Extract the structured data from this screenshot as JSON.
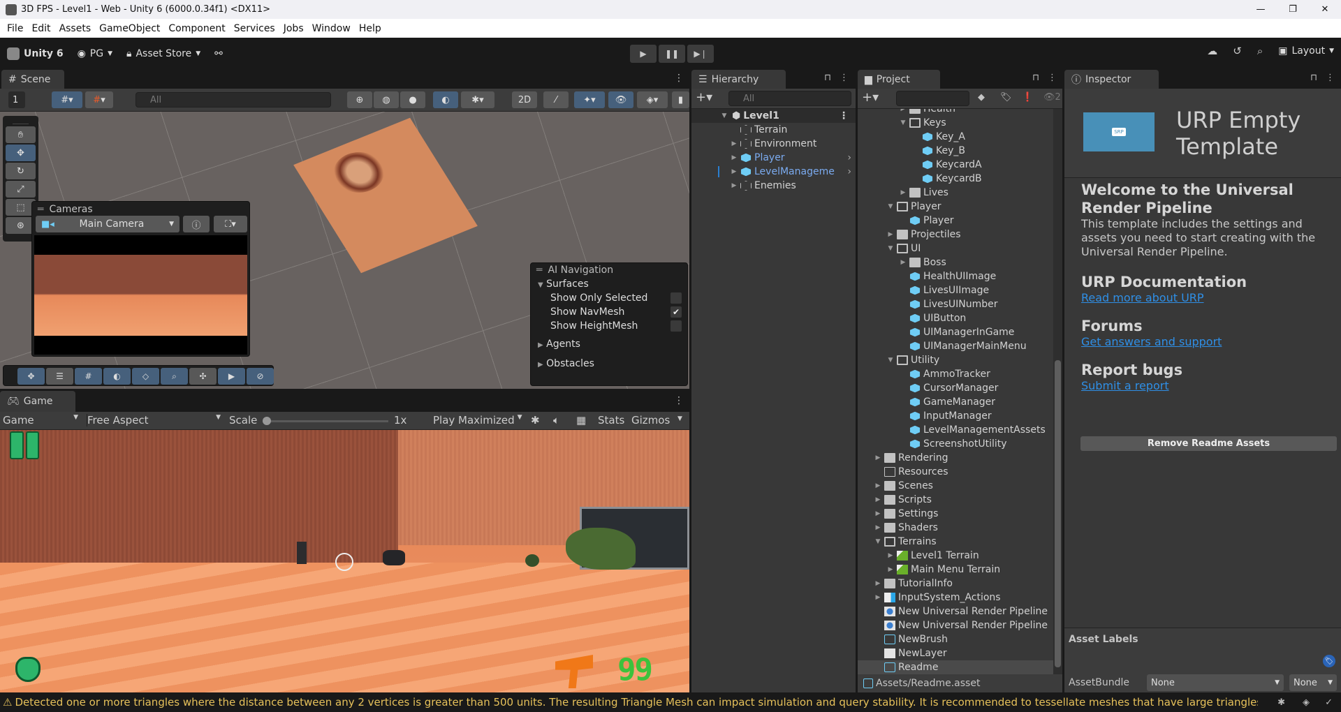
{
  "window": {
    "title": "3D FPS - Level1 - Web - Unity 6 (6000.0.34f1) <DX11>",
    "min": "—",
    "max": "❐",
    "close": "✕"
  },
  "menu": [
    "File",
    "Edit",
    "Assets",
    "GameObject",
    "Component",
    "Services",
    "Jobs",
    "Window",
    "Help"
  ],
  "toolbar": {
    "unity": "Unity 6",
    "account": "PG",
    "asset_store": "Asset Store",
    "layout": "Layout"
  },
  "scene": {
    "tab": "Scene",
    "grid_value": "1",
    "search_placeholder": "All",
    "cameras": {
      "title": "Cameras",
      "camera": "Main Camera"
    },
    "ai_nav": {
      "title": "AI Navigation",
      "surfaces": "Surfaces",
      "options": [
        {
          "label": "Show Only Selected",
          "checked": false
        },
        {
          "label": "Show NavMesh",
          "checked": true
        },
        {
          "label": "Show HeightMesh",
          "checked": false
        }
      ],
      "agents": "Agents",
      "obstacles": "Obstacles"
    }
  },
  "game": {
    "tab": "Game",
    "display": "Game",
    "aspect": "Free Aspect",
    "scale_label": "Scale",
    "scale_value": "1x",
    "scale": 0,
    "play_mode": "Play Maximized",
    "stats": "Stats",
    "gizmos": "Gizmos",
    "ammo": "99"
  },
  "hierarchy": {
    "tab": "Hierarchy",
    "search_placeholder": "All",
    "scene": "Level1",
    "items": [
      {
        "label": "Terrain",
        "icon": "gameobject",
        "arrow": false,
        "prefab": false
      },
      {
        "label": "Environment",
        "icon": "gameobject",
        "arrow": true,
        "prefab": false
      },
      {
        "label": "Player",
        "icon": "prefab",
        "arrow": true,
        "prefab": true
      },
      {
        "label": "LevelManageme",
        "icon": "prefab",
        "arrow": true,
        "prefab": true
      },
      {
        "label": "Enemies",
        "icon": "gameobject",
        "arrow": true,
        "prefab": false
      }
    ]
  },
  "project": {
    "tab": "Project",
    "hidden_count": "2",
    "path": "Assets/Readme.asset",
    "items": [
      {
        "l": 2,
        "a": "c",
        "i": "fold",
        "t": "Health"
      },
      {
        "l": 2,
        "a": "o",
        "i": "fold open",
        "t": "Keys"
      },
      {
        "l": 3,
        "a": "",
        "i": "prefab",
        "t": "Key_A"
      },
      {
        "l": 3,
        "a": "",
        "i": "prefab",
        "t": "Key_B"
      },
      {
        "l": 3,
        "a": "",
        "i": "prefab",
        "t": "KeycardA"
      },
      {
        "l": 3,
        "a": "",
        "i": "prefab",
        "t": "KeycardB"
      },
      {
        "l": 2,
        "a": "c",
        "i": "fold",
        "t": "Lives"
      },
      {
        "l": 1,
        "a": "o",
        "i": "fold open",
        "t": "Player"
      },
      {
        "l": 2,
        "a": "",
        "i": "prefab",
        "t": "Player"
      },
      {
        "l": 1,
        "a": "c",
        "i": "fold",
        "t": "Projectiles"
      },
      {
        "l": 1,
        "a": "o",
        "i": "fold open",
        "t": "UI"
      },
      {
        "l": 2,
        "a": "c",
        "i": "fold",
        "t": "Boss"
      },
      {
        "l": 2,
        "a": "",
        "i": "prefab",
        "t": "HealthUIImage"
      },
      {
        "l": 2,
        "a": "",
        "i": "prefab",
        "t": "LivesUIImage"
      },
      {
        "l": 2,
        "a": "",
        "i": "prefab",
        "t": "LivesUINumber"
      },
      {
        "l": 2,
        "a": "",
        "i": "prefab",
        "t": "UIButton"
      },
      {
        "l": 2,
        "a": "",
        "i": "prefab",
        "t": "UIManagerInGame"
      },
      {
        "l": 2,
        "a": "",
        "i": "prefab",
        "t": "UIManagerMainMenu"
      },
      {
        "l": 1,
        "a": "o",
        "i": "fold open",
        "t": "Utility"
      },
      {
        "l": 2,
        "a": "",
        "i": "prefab",
        "t": "AmmoTracker"
      },
      {
        "l": 2,
        "a": "",
        "i": "prefab",
        "t": "CursorManager"
      },
      {
        "l": 2,
        "a": "",
        "i": "prefab",
        "t": "GameManager"
      },
      {
        "l": 2,
        "a": "",
        "i": "prefab",
        "t": "InputManager"
      },
      {
        "l": 2,
        "a": "",
        "i": "prefab",
        "t": "LevelManagementAssets"
      },
      {
        "l": 2,
        "a": "",
        "i": "prefab",
        "t": "ScreenshotUtility"
      },
      {
        "l": 0,
        "a": "c",
        "i": "fold",
        "t": "Rendering"
      },
      {
        "l": 0,
        "a": "",
        "i": "fold empty",
        "t": "Resources"
      },
      {
        "l": 0,
        "a": "c",
        "i": "fold",
        "t": "Scenes"
      },
      {
        "l": 0,
        "a": "c",
        "i": "fold",
        "t": "Scripts"
      },
      {
        "l": 0,
        "a": "c",
        "i": "fold",
        "t": "Settings"
      },
      {
        "l": 0,
        "a": "c",
        "i": "fold",
        "t": "Shaders"
      },
      {
        "l": 0,
        "a": "o",
        "i": "fold open",
        "t": "Terrains"
      },
      {
        "l": 1,
        "a": "c",
        "i": "terr",
        "t": "Level1 Terrain"
      },
      {
        "l": 1,
        "a": "c",
        "i": "terr",
        "t": "Main Menu Terrain"
      },
      {
        "l": 0,
        "a": "c",
        "i": "fold",
        "t": "TutorialInfo"
      },
      {
        "l": 0,
        "a": "c",
        "i": "is",
        "t": "InputSystem_Actions"
      },
      {
        "l": 0,
        "a": "",
        "i": "rp",
        "t": "New Universal Render Pipeline"
      },
      {
        "l": 0,
        "a": "",
        "i": "rp",
        "t": "New Universal Render Pipeline"
      },
      {
        "l": 0,
        "a": "",
        "i": "scr",
        "t": "NewBrush"
      },
      {
        "l": 0,
        "a": "",
        "i": "doc",
        "t": "NewLayer"
      },
      {
        "l": 0,
        "a": "",
        "i": "scr",
        "t": "Readme",
        "sel": true
      }
    ]
  },
  "inspector": {
    "tab": "Inspector",
    "title": "URP Empty Template",
    "thumb_text": "SRP",
    "welcome_heading": "Welcome to the Universal Render Pipeline",
    "welcome_body": "This template includes the settings and assets you need to start creating with the Universal Render Pipeline.",
    "sections": [
      {
        "heading": "URP Documentation",
        "link": "Read more about URP"
      },
      {
        "heading": "Forums",
        "link": "Get answers and support"
      },
      {
        "heading": "Report bugs",
        "link": "Submit a report"
      }
    ],
    "remove_button": "Remove Readme Assets",
    "asset_labels": "Asset Labels",
    "asset_bundle": "AssetBundle",
    "bundle_value": "None",
    "variant_value": "None"
  },
  "status": {
    "message": "Detected one or more triangles where the distance between any 2 vertices is greater than 500 units. The resulting Triangle Mesh can impact simulation and query stability. It is recommended to tessellate meshes that have large triangles. Source m",
    "color": "#e6c15a"
  },
  "colors": {
    "accent": "#46607c",
    "link": "#2f8fe6",
    "prefab": "#6fcdf5"
  }
}
